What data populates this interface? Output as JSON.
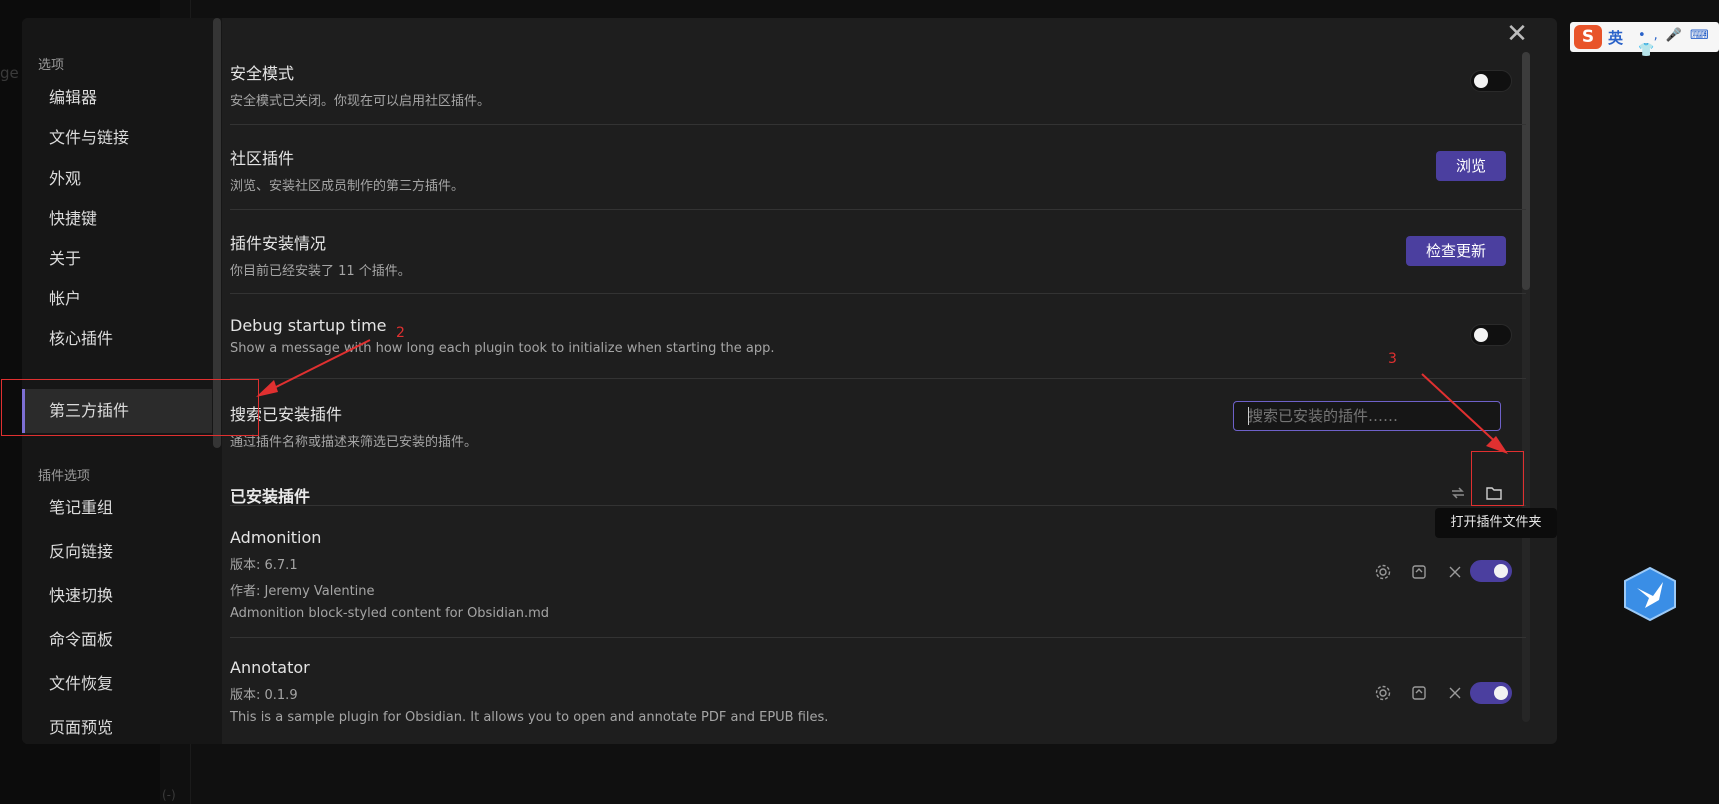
{
  "background": {
    "fragment_left": "ge :",
    "fragment_bottom": "(-)"
  },
  "sidebar": {
    "options_heading": "选项",
    "items": [
      "编辑器",
      "文件与链接",
      "外观",
      "快捷键",
      "关于",
      "帐户",
      "核心插件",
      "第三方插件"
    ],
    "active_index": 7,
    "plugin_options_heading": "插件选项",
    "plugin_items": [
      "笔记重组",
      "反向链接",
      "快速切换",
      "命令面板",
      "文件恢复",
      "页面预览"
    ]
  },
  "settings": {
    "safe_mode": {
      "title": "安全模式",
      "desc": "安全模式已关闭。你现在可以启用社区插件。",
      "enabled": false
    },
    "community": {
      "title": "社区插件",
      "desc": "浏览、安装社区成员制作的第三方插件。",
      "button": "浏览"
    },
    "installed_status": {
      "title": "插件安装情况",
      "desc": "你目前已经安装了 11 个插件。",
      "button": "检查更新"
    },
    "debug": {
      "title": "Debug startup time",
      "desc": "Show a message with how long each plugin took to initialize when starting the app.",
      "enabled": false
    },
    "search": {
      "title": "搜索已安装插件",
      "desc": "通过插件名称或描述来筛选已安装的插件。",
      "placeholder": "搜索已安装的插件……"
    }
  },
  "installed": {
    "heading": "已安装插件",
    "tooltip": "打开插件文件夹",
    "plugins": [
      {
        "name": "Admonition",
        "version": "版本: 6.7.1",
        "author": "作者: Jeremy Valentine",
        "desc": "Admonition block-styled content for Obsidian.md",
        "enabled": true
      },
      {
        "name": "Annotator",
        "version": "版本: 0.1.9",
        "desc": "This is a sample plugin for Obsidian. It allows you to open and annotate PDF and EPUB files.",
        "enabled": true
      }
    ]
  },
  "annotations": {
    "arrow2_label": "2",
    "arrow3_label": "3"
  },
  "ime": {
    "label": "英"
  },
  "colors": {
    "accent": "#4b3f9f",
    "annotation": "#e03030",
    "modal_bg": "#1e1e1e"
  },
  "icons": [
    "close-icon",
    "refresh-icon",
    "folder-icon",
    "gear-icon",
    "hotkey-icon",
    "uninstall-icon",
    "bird-icon"
  ]
}
